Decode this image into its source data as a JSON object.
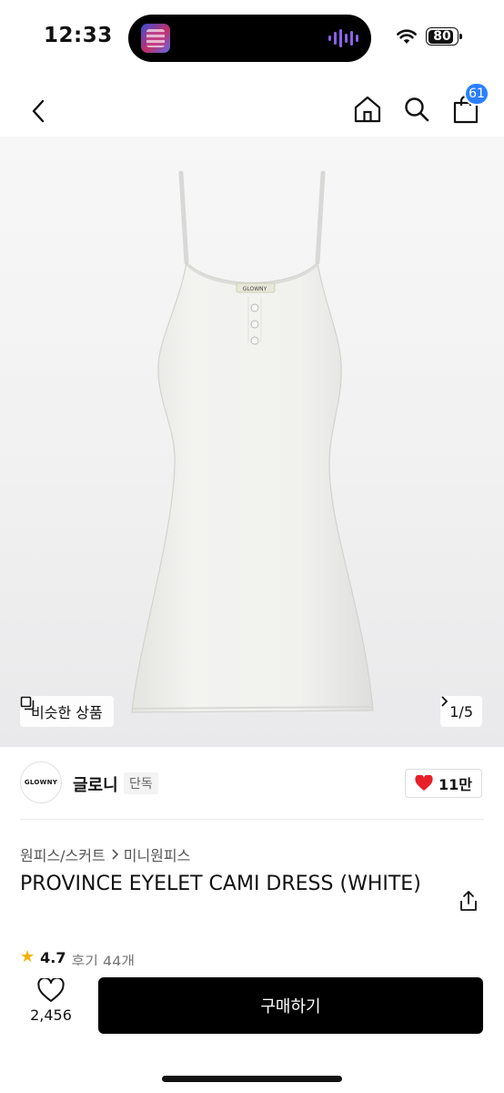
{
  "status_bar": {
    "time": "12:33",
    "battery": "80"
  },
  "nav": {
    "cart_count": "61"
  },
  "gallery": {
    "similar_label": "비슷한 상품",
    "page_indicator": "1/5"
  },
  "product_image": {
    "dress_label": "GLOWNY"
  },
  "brand": {
    "logo_text": "GLOWNY",
    "name": "글로니",
    "tag": "단독",
    "likes": "11만"
  },
  "breadcrumb": {
    "category": "원피스/스커트",
    "subcategory": "미니원피스"
  },
  "product": {
    "title": "PROVINCE EYELET CAMI DRESS (WHITE)"
  },
  "rating": {
    "score": "4.7",
    "reviews": "후기 44개"
  },
  "bottom": {
    "wish_count": "2,456",
    "buy_label": "구매하기"
  },
  "colors": {
    "accent": "#2b7fff",
    "heart": "#e8202a",
    "buy_bg": "#000000",
    "star": "#f2b300"
  }
}
